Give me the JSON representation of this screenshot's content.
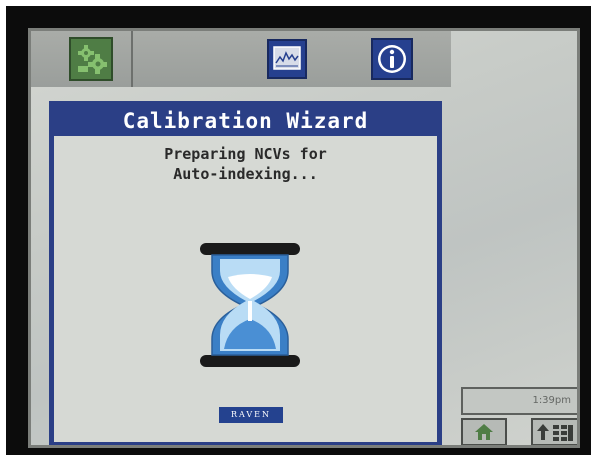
{
  "toolbar": {
    "machine_icon": "machine-gear-icon",
    "graph_icon": "graph-monitor-icon",
    "info_icon": "info-icon",
    "info_label": "i"
  },
  "wizard": {
    "title": "Calibration Wizard",
    "message_line1": "Preparing NCVs for",
    "message_line2": "Auto-indexing...",
    "busy_icon": "hourglass-icon",
    "brand": "RAVEN"
  },
  "status": {
    "time": "1:39pm"
  },
  "softkeys": {
    "home_icon": "home-icon",
    "menu_icon": "up-arrow-grid-icon"
  },
  "colors": {
    "title_bar": "#2b3f86",
    "machine_button": "#4f7d45",
    "screen_bg": "#c7cbc7",
    "hourglass_glass": "#3a7fc6"
  }
}
